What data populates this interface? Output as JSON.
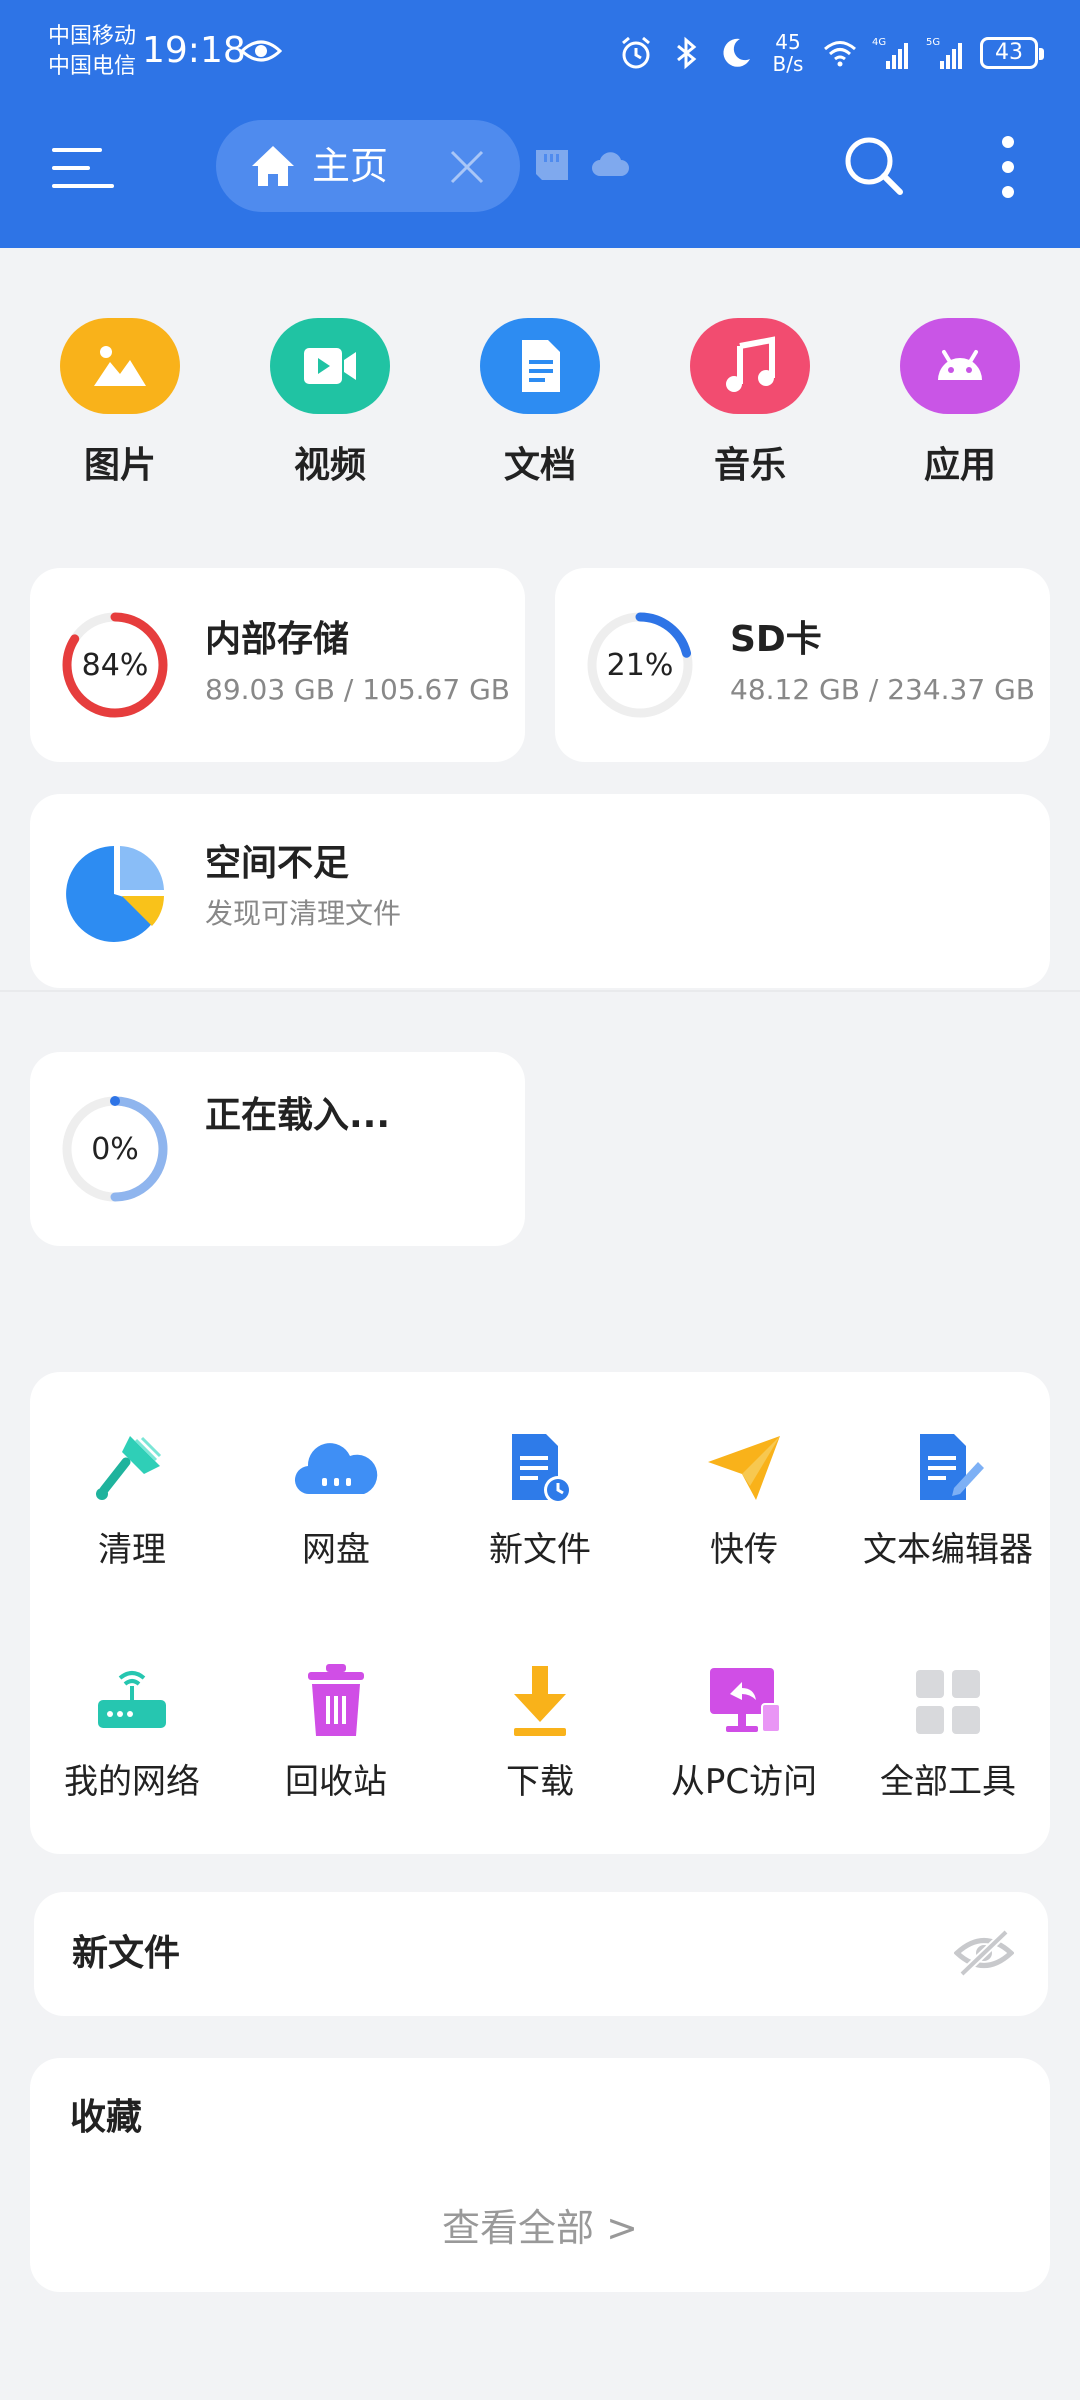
{
  "status_bar": {
    "carrier_1": "中国移动",
    "carrier_2": "中国电信",
    "time": "19:18",
    "net_speed_value": "45",
    "net_speed_unit": "B/s",
    "battery": "43"
  },
  "toolbar": {
    "tab_label": "主页"
  },
  "categories": [
    {
      "label": "图片",
      "color": "#f9b21a",
      "icon": "image-icon"
    },
    {
      "label": "视频",
      "color": "#20c3a3",
      "icon": "video-icon"
    },
    {
      "label": "文档",
      "color": "#2d8cf2",
      "icon": "document-icon"
    },
    {
      "label": "音乐",
      "color": "#f24c70",
      "icon": "music-icon"
    },
    {
      "label": "应用",
      "color": "#c955e6",
      "icon": "android-icon"
    }
  ],
  "storage": {
    "internal": {
      "title": "内部存储",
      "percent_label": "84%",
      "percent": 84,
      "usage": "89.03 GB / 105.67 GB",
      "color": "#e63d3d"
    },
    "sd": {
      "title": "SD卡",
      "percent_label": "21%",
      "percent": 21,
      "usage": "48.12 GB / 234.37 GB",
      "color": "#2e74e6"
    }
  },
  "low_space": {
    "title": "空间不足",
    "subtitle": "发现可清理文件"
  },
  "loading": {
    "title": "正在载入...",
    "percent_label": "0%"
  },
  "tools": [
    {
      "label": "清理",
      "icon": "broom-icon"
    },
    {
      "label": "网盘",
      "icon": "cloud-drive-icon"
    },
    {
      "label": "新文件",
      "icon": "new-file-icon"
    },
    {
      "label": "快传",
      "icon": "paper-plane-icon"
    },
    {
      "label": "文本编辑器",
      "icon": "text-editor-icon"
    },
    {
      "label": "我的网络",
      "icon": "router-icon"
    },
    {
      "label": "回收站",
      "icon": "trash-icon"
    },
    {
      "label": "下载",
      "icon": "download-icon"
    },
    {
      "label": "从PC访问",
      "icon": "pc-access-icon"
    },
    {
      "label": "全部工具",
      "icon": "grid-icon"
    }
  ],
  "new_files": {
    "title": "新文件"
  },
  "favorites": {
    "title": "收藏",
    "view_all": "查看全部 >"
  },
  "colors": {
    "primary": "#2e74e6",
    "background": "#f2f3f5"
  }
}
